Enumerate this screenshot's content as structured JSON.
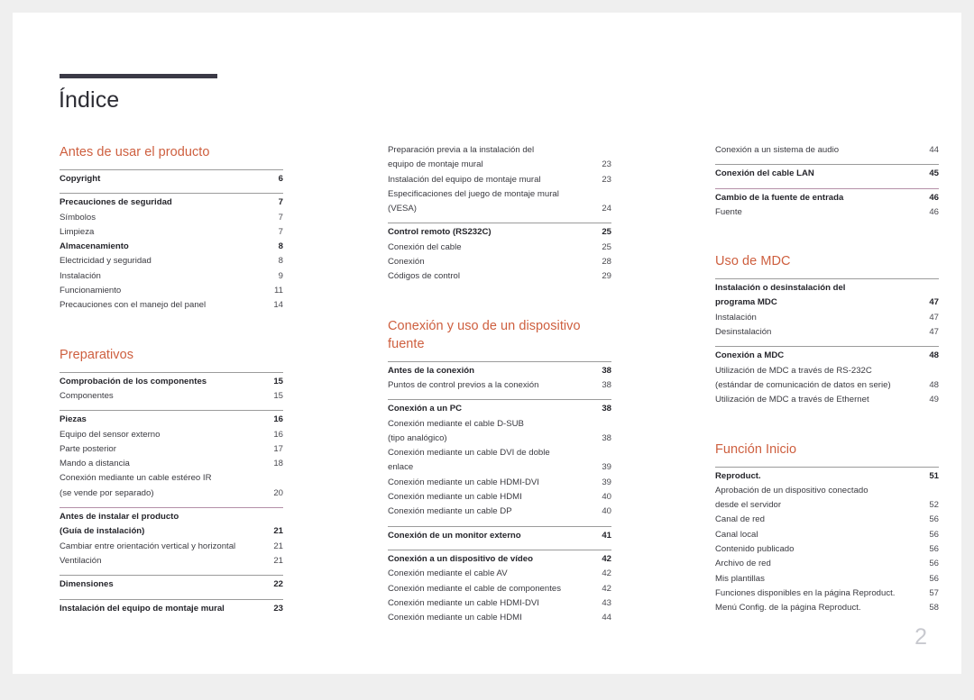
{
  "document": {
    "title": "Índice",
    "folio": "2",
    "accent_color": "#ce5f3f",
    "rule_color": "#3b3a46",
    "divider_color": "#9b9b9b",
    "mauve_divider_color": "#b48fa8"
  },
  "columns": [
    {
      "id": "column-left",
      "sections": [
        {
          "heading": "Antes de usar el producto",
          "groups": [
            {
              "rule": "gray",
              "entries": [
                {
                  "label": "Copyright",
                  "page": "6",
                  "bold": true
                }
              ]
            },
            {
              "rule": "gray",
              "entries": [
                {
                  "label": "Precauciones de seguridad",
                  "page": "7",
                  "bold": true
                },
                {
                  "label": "Símbolos",
                  "page": "7",
                  "bold": false
                },
                {
                  "label": "Limpieza",
                  "page": "7",
                  "bold": false
                },
                {
                  "label": "Almacenamiento",
                  "page": "8",
                  "bold": true
                },
                {
                  "label": "Electricidad y seguridad",
                  "page": "8",
                  "bold": false
                },
                {
                  "label": "Instalación",
                  "page": "9",
                  "bold": false
                },
                {
                  "label": "Funcionamiento",
                  "page": "11",
                  "bold": false
                },
                {
                  "label": "Precauciones con el manejo del panel",
                  "page": "14",
                  "bold": false
                }
              ]
            }
          ]
        },
        {
          "heading": "Preparativos",
          "groups": [
            {
              "rule": "gray",
              "entries": [
                {
                  "label": "Comprobación de los componentes",
                  "page": "15",
                  "bold": true
                },
                {
                  "label": "Componentes",
                  "page": "15",
                  "bold": false
                }
              ]
            },
            {
              "rule": "gray",
              "entries": [
                {
                  "label": "Piezas",
                  "page": "16",
                  "bold": true
                },
                {
                  "label": "Equipo del sensor externo",
                  "page": "16",
                  "bold": false
                },
                {
                  "label": "Parte posterior",
                  "page": "17",
                  "bold": false
                },
                {
                  "label": "Mando a distancia",
                  "page": "18",
                  "bold": false
                },
                {
                  "label": "Conexión mediante un cable estéreo IR\n(se vende por separado)",
                  "page": "20",
                  "bold": false,
                  "wrapped": true
                }
              ]
            },
            {
              "rule": "mauve",
              "entries": [
                {
                  "label": "Antes de instalar el producto\n(Guía de instalación)",
                  "page": "21",
                  "bold": true,
                  "wrapped": true
                },
                {
                  "label": "Cambiar entre orientación vertical y horizontal",
                  "page": "21",
                  "bold": false
                },
                {
                  "label": "Ventilación",
                  "page": "21",
                  "bold": false
                }
              ]
            },
            {
              "rule": "gray",
              "entries": [
                {
                  "label": "Dimensiones",
                  "page": "22",
                  "bold": true
                }
              ]
            },
            {
              "rule": "gray",
              "entries": [
                {
                  "label": "Instalación del equipo de montaje mural",
                  "page": "23",
                  "bold": true
                }
              ]
            }
          ]
        }
      ]
    },
    {
      "id": "column-middle",
      "sections": [
        {
          "heading": "",
          "groups": [
            {
              "rule": "none",
              "entries": [
                {
                  "label": "Preparación previa a la instalación del\nequipo de montaje mural",
                  "page": "23",
                  "bold": false,
                  "wrapped": true
                },
                {
                  "label": "Instalación del equipo de montaje mural",
                  "page": "23",
                  "bold": false
                },
                {
                  "label": "Especificaciones del juego de montaje mural\n(VESA)",
                  "page": "24",
                  "bold": false,
                  "wrapped": true
                }
              ]
            },
            {
              "rule": "gray",
              "entries": [
                {
                  "label": "Control remoto (RS232C)",
                  "page": "25",
                  "bold": true
                },
                {
                  "label": "Conexión del cable",
                  "page": "25",
                  "bold": false
                },
                {
                  "label": "Conexión",
                  "page": "28",
                  "bold": false
                },
                {
                  "label": "Códigos de control",
                  "page": "29",
                  "bold": false
                }
              ]
            }
          ]
        },
        {
          "heading": "Conexión y uso de un dispositivo\nfuente",
          "groups": [
            {
              "rule": "gray",
              "entries": [
                {
                  "label": "Antes de la conexión",
                  "page": "38",
                  "bold": true
                },
                {
                  "label": "Puntos de control previos a la conexión",
                  "page": "38",
                  "bold": false
                }
              ]
            },
            {
              "rule": "gray",
              "entries": [
                {
                  "label": "Conexión a un PC",
                  "page": "38",
                  "bold": true
                },
                {
                  "label": "Conexión mediante el cable D-SUB\n(tipo analógico)",
                  "page": "38",
                  "bold": false,
                  "wrapped": true
                },
                {
                  "label": "Conexión mediante un cable DVI de doble\nenlace",
                  "page": "39",
                  "bold": false,
                  "wrapped": true
                },
                {
                  "label": "Conexión mediante un cable HDMI-DVI",
                  "page": "39",
                  "bold": false
                },
                {
                  "label": "Conexión mediante un cable HDMI",
                  "page": "40",
                  "bold": false
                },
                {
                  "label": "Conexión mediante un cable DP",
                  "page": "40",
                  "bold": false
                }
              ]
            },
            {
              "rule": "gray",
              "entries": [
                {
                  "label": "Conexión de un monitor externo",
                  "page": "41",
                  "bold": true
                }
              ]
            },
            {
              "rule": "gray",
              "entries": [
                {
                  "label": "Conexión a un dispositivo de vídeo",
                  "page": "42",
                  "bold": true
                },
                {
                  "label": "Conexión mediante el cable AV",
                  "page": "42",
                  "bold": false
                },
                {
                  "label": "Conexión mediante el cable de componentes",
                  "page": "42",
                  "bold": false
                },
                {
                  "label": "Conexión mediante un cable HDMI-DVI",
                  "page": "43",
                  "bold": false
                },
                {
                  "label": "Conexión mediante un cable HDMI",
                  "page": "44",
                  "bold": false
                }
              ]
            }
          ]
        }
      ]
    },
    {
      "id": "column-right",
      "sections": [
        {
          "heading": "",
          "groups": [
            {
              "rule": "none",
              "entries": [
                {
                  "label": "Conexión a un sistema de audio",
                  "page": "44",
                  "bold": false
                }
              ]
            },
            {
              "rule": "gray",
              "entries": [
                {
                  "label": "Conexión del cable LAN",
                  "page": "45",
                  "bold": true
                }
              ]
            },
            {
              "rule": "mauve",
              "entries": [
                {
                  "label": "Cambio de la fuente de entrada",
                  "page": "46",
                  "bold": true
                },
                {
                  "label": "Fuente",
                  "page": "46",
                  "bold": false
                }
              ]
            }
          ]
        },
        {
          "heading": "Uso de MDC",
          "groups": [
            {
              "rule": "gray",
              "entries": [
                {
                  "label": "Instalación o desinstalación del\nprograma MDC",
                  "page": "47",
                  "bold": true,
                  "wrapped": true
                },
                {
                  "label": "Instalación",
                  "page": "47",
                  "bold": false
                },
                {
                  "label": "Desinstalación",
                  "page": "47",
                  "bold": false
                }
              ]
            },
            {
              "rule": "gray",
              "entries": [
                {
                  "label": "Conexión a MDC",
                  "page": "48",
                  "bold": true
                },
                {
                  "label": "Utilización de MDC a través de RS-232C\n(estándar de comunicación de datos en serie)",
                  "page": "48",
                  "bold": false,
                  "wrapped": true
                },
                {
                  "label": "Utilización de MDC a través de Ethernet",
                  "page": "49",
                  "bold": false
                }
              ]
            }
          ]
        },
        {
          "heading": "Función Inicio",
          "groups": [
            {
              "rule": "gray",
              "entries": [
                {
                  "label": "Reproduct.",
                  "page": "51",
                  "bold": true
                },
                {
                  "label": "Aprobación de un dispositivo conectado\ndesde el servidor",
                  "page": "52",
                  "bold": false,
                  "wrapped": true
                },
                {
                  "label": "Canal de red",
                  "page": "56",
                  "bold": false
                },
                {
                  "label": "Canal local",
                  "page": "56",
                  "bold": false
                },
                {
                  "label": "Contenido publicado",
                  "page": "56",
                  "bold": false
                },
                {
                  "label": "Archivo de red",
                  "page": "56",
                  "bold": false
                },
                {
                  "label": "Mis plantillas",
                  "page": "56",
                  "bold": false
                },
                {
                  "label": "Funciones disponibles en la página Reproduct.",
                  "page": "57",
                  "bold": false
                },
                {
                  "label": "Menú Config. de la página Reproduct.",
                  "page": "58",
                  "bold": false
                }
              ]
            }
          ]
        }
      ]
    }
  ]
}
